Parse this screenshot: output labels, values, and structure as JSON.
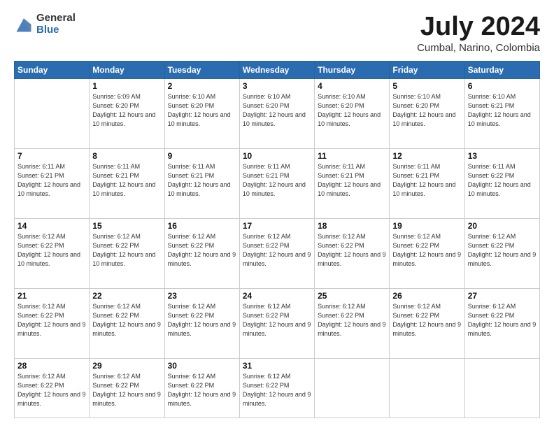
{
  "logo": {
    "general": "General",
    "blue": "Blue"
  },
  "header": {
    "title": "July 2024",
    "subtitle": "Cumbal, Narino, Colombia"
  },
  "weekdays": [
    "Sunday",
    "Monday",
    "Tuesday",
    "Wednesday",
    "Thursday",
    "Friday",
    "Saturday"
  ],
  "weeks": [
    [
      {
        "day": "",
        "sunrise": "",
        "sunset": "",
        "daylight": ""
      },
      {
        "day": "1",
        "sunrise": "Sunrise: 6:09 AM",
        "sunset": "Sunset: 6:20 PM",
        "daylight": "Daylight: 12 hours and 10 minutes."
      },
      {
        "day": "2",
        "sunrise": "Sunrise: 6:10 AM",
        "sunset": "Sunset: 6:20 PM",
        "daylight": "Daylight: 12 hours and 10 minutes."
      },
      {
        "day": "3",
        "sunrise": "Sunrise: 6:10 AM",
        "sunset": "Sunset: 6:20 PM",
        "daylight": "Daylight: 12 hours and 10 minutes."
      },
      {
        "day": "4",
        "sunrise": "Sunrise: 6:10 AM",
        "sunset": "Sunset: 6:20 PM",
        "daylight": "Daylight: 12 hours and 10 minutes."
      },
      {
        "day": "5",
        "sunrise": "Sunrise: 6:10 AM",
        "sunset": "Sunset: 6:20 PM",
        "daylight": "Daylight: 12 hours and 10 minutes."
      },
      {
        "day": "6",
        "sunrise": "Sunrise: 6:10 AM",
        "sunset": "Sunset: 6:21 PM",
        "daylight": "Daylight: 12 hours and 10 minutes."
      }
    ],
    [
      {
        "day": "7",
        "sunrise": "Sunrise: 6:11 AM",
        "sunset": "Sunset: 6:21 PM",
        "daylight": "Daylight: 12 hours and 10 minutes."
      },
      {
        "day": "8",
        "sunrise": "Sunrise: 6:11 AM",
        "sunset": "Sunset: 6:21 PM",
        "daylight": "Daylight: 12 hours and 10 minutes."
      },
      {
        "day": "9",
        "sunrise": "Sunrise: 6:11 AM",
        "sunset": "Sunset: 6:21 PM",
        "daylight": "Daylight: 12 hours and 10 minutes."
      },
      {
        "day": "10",
        "sunrise": "Sunrise: 6:11 AM",
        "sunset": "Sunset: 6:21 PM",
        "daylight": "Daylight: 12 hours and 10 minutes."
      },
      {
        "day": "11",
        "sunrise": "Sunrise: 6:11 AM",
        "sunset": "Sunset: 6:21 PM",
        "daylight": "Daylight: 12 hours and 10 minutes."
      },
      {
        "day": "12",
        "sunrise": "Sunrise: 6:11 AM",
        "sunset": "Sunset: 6:21 PM",
        "daylight": "Daylight: 12 hours and 10 minutes."
      },
      {
        "day": "13",
        "sunrise": "Sunrise: 6:11 AM",
        "sunset": "Sunset: 6:22 PM",
        "daylight": "Daylight: 12 hours and 10 minutes."
      }
    ],
    [
      {
        "day": "14",
        "sunrise": "Sunrise: 6:12 AM",
        "sunset": "Sunset: 6:22 PM",
        "daylight": "Daylight: 12 hours and 10 minutes."
      },
      {
        "day": "15",
        "sunrise": "Sunrise: 6:12 AM",
        "sunset": "Sunset: 6:22 PM",
        "daylight": "Daylight: 12 hours and 10 minutes."
      },
      {
        "day": "16",
        "sunrise": "Sunrise: 6:12 AM",
        "sunset": "Sunset: 6:22 PM",
        "daylight": "Daylight: 12 hours and 9 minutes."
      },
      {
        "day": "17",
        "sunrise": "Sunrise: 6:12 AM",
        "sunset": "Sunset: 6:22 PM",
        "daylight": "Daylight: 12 hours and 9 minutes."
      },
      {
        "day": "18",
        "sunrise": "Sunrise: 6:12 AM",
        "sunset": "Sunset: 6:22 PM",
        "daylight": "Daylight: 12 hours and 9 minutes."
      },
      {
        "day": "19",
        "sunrise": "Sunrise: 6:12 AM",
        "sunset": "Sunset: 6:22 PM",
        "daylight": "Daylight: 12 hours and 9 minutes."
      },
      {
        "day": "20",
        "sunrise": "Sunrise: 6:12 AM",
        "sunset": "Sunset: 6:22 PM",
        "daylight": "Daylight: 12 hours and 9 minutes."
      }
    ],
    [
      {
        "day": "21",
        "sunrise": "Sunrise: 6:12 AM",
        "sunset": "Sunset: 6:22 PM",
        "daylight": "Daylight: 12 hours and 9 minutes."
      },
      {
        "day": "22",
        "sunrise": "Sunrise: 6:12 AM",
        "sunset": "Sunset: 6:22 PM",
        "daylight": "Daylight: 12 hours and 9 minutes."
      },
      {
        "day": "23",
        "sunrise": "Sunrise: 6:12 AM",
        "sunset": "Sunset: 6:22 PM",
        "daylight": "Daylight: 12 hours and 9 minutes."
      },
      {
        "day": "24",
        "sunrise": "Sunrise: 6:12 AM",
        "sunset": "Sunset: 6:22 PM",
        "daylight": "Daylight: 12 hours and 9 minutes."
      },
      {
        "day": "25",
        "sunrise": "Sunrise: 6:12 AM",
        "sunset": "Sunset: 6:22 PM",
        "daylight": "Daylight: 12 hours and 9 minutes."
      },
      {
        "day": "26",
        "sunrise": "Sunrise: 6:12 AM",
        "sunset": "Sunset: 6:22 PM",
        "daylight": "Daylight: 12 hours and 9 minutes."
      },
      {
        "day": "27",
        "sunrise": "Sunrise: 6:12 AM",
        "sunset": "Sunset: 6:22 PM",
        "daylight": "Daylight: 12 hours and 9 minutes."
      }
    ],
    [
      {
        "day": "28",
        "sunrise": "Sunrise: 6:12 AM",
        "sunset": "Sunset: 6:22 PM",
        "daylight": "Daylight: 12 hours and 9 minutes."
      },
      {
        "day": "29",
        "sunrise": "Sunrise: 6:12 AM",
        "sunset": "Sunset: 6:22 PM",
        "daylight": "Daylight: 12 hours and 9 minutes."
      },
      {
        "day": "30",
        "sunrise": "Sunrise: 6:12 AM",
        "sunset": "Sunset: 6:22 PM",
        "daylight": "Daylight: 12 hours and 9 minutes."
      },
      {
        "day": "31",
        "sunrise": "Sunrise: 6:12 AM",
        "sunset": "Sunset: 6:22 PM",
        "daylight": "Daylight: 12 hours and 9 minutes."
      },
      {
        "day": "",
        "sunrise": "",
        "sunset": "",
        "daylight": ""
      },
      {
        "day": "",
        "sunrise": "",
        "sunset": "",
        "daylight": ""
      },
      {
        "day": "",
        "sunrise": "",
        "sunset": "",
        "daylight": ""
      }
    ]
  ]
}
